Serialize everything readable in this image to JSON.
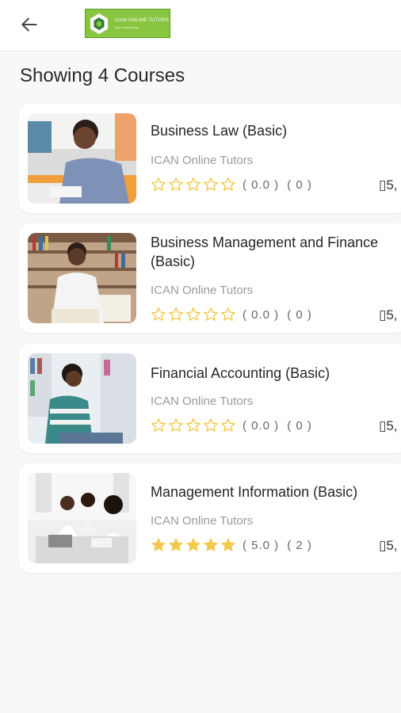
{
  "header": {
    "back_icon": "arrow-left-icon",
    "logo": {
      "line1": "ICAN ONLINE TUTORS",
      "line2": "ican online tutors",
      "color": "#88c540"
    }
  },
  "heading": "Showing 4 Courses",
  "colors": {
    "star_filled": "#f2c94c",
    "star_outline": "#f2c94c",
    "accent": "#88c540"
  },
  "courses": [
    {
      "title": "Business Law (Basic)",
      "tutor": "ICAN Online Tutors",
      "rating": 0,
      "score": "( 0.0 )",
      "count": "( 0 )",
      "price": "▯5,"
    },
    {
      "title": "Business Management and Finance (Basic)",
      "tutor": "ICAN Online Tutors",
      "rating": 0,
      "score": "( 0.0 )",
      "count": "( 0 )",
      "price": "▯5,"
    },
    {
      "title": "Financial Accounting (Basic)",
      "tutor": "ICAN Online Tutors",
      "rating": 0,
      "score": "( 0.0 )",
      "count": "( 0 )",
      "price": "▯5,"
    },
    {
      "title": "Management Information (Basic)",
      "tutor": "ICAN Online Tutors",
      "rating": 5,
      "score": "( 5.0 )",
      "count": "( 2 )",
      "price": "▯5,"
    }
  ]
}
